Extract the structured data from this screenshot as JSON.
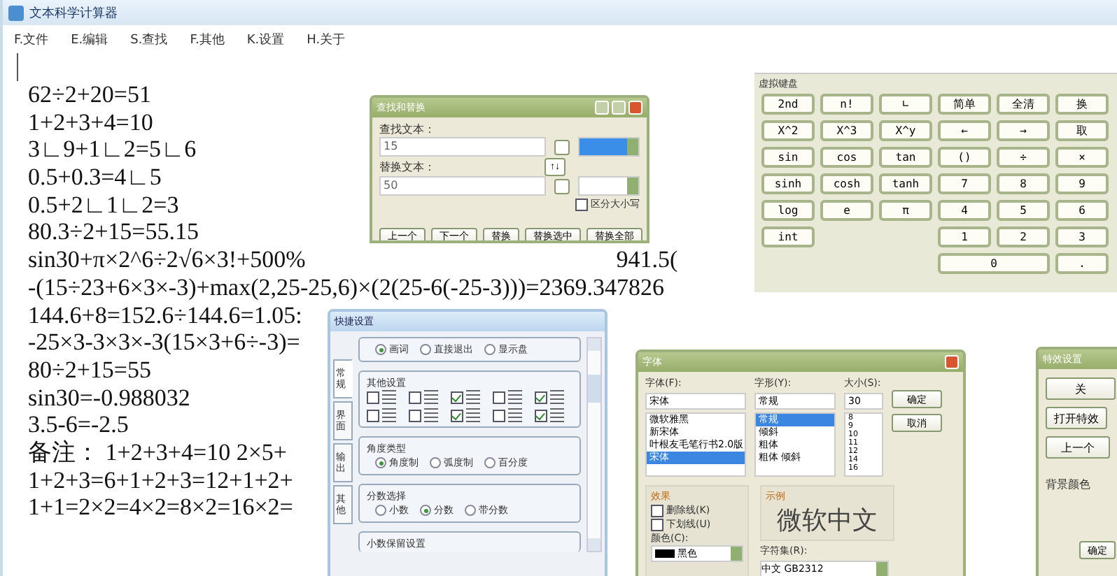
{
  "window": {
    "title": "文本科学计算器"
  },
  "menu": [
    {
      "label": "F.文件"
    },
    {
      "label": "E.编辑"
    },
    {
      "label": "S.查找"
    },
    {
      "label": "F.其他"
    },
    {
      "label": "K.设置"
    },
    {
      "label": "H.关于"
    }
  ],
  "document": {
    "lines": [
      {
        "text": "62÷2+20=51"
      },
      {
        "text": "1+2+3+4=10"
      },
      {
        "text": "3∟9+1∟2=5∟6"
      },
      {
        "text": "0.5+0.3=4∟5"
      },
      {
        "text": "0.5+2∟1∟2=3"
      },
      {
        "text": "80.3÷2+15=55.15"
      },
      {
        "text": "sin30+π×2^6÷2√6×3!+500%",
        "tail": "941.5("
      },
      {
        "text": "-(15÷23+6×3×-3)+max(2,25-25,6)×(2(25-6(-25-3)))=2369.347826"
      },
      {
        "text": "144.6+8=152.6÷144.6=1.05:"
      },
      {
        "text": "-25×3-3×3×-3(15×3+6÷-3)="
      },
      {
        "text": "80÷2+15=55"
      },
      {
        "text": "sin30=-0.988032"
      },
      {
        "text": "3.5-6=-2.5"
      },
      {
        "text": "备注：  1+2+3+4=10  2×5+"
      },
      {
        "text": "1+2+3=6+1+2+3=12+1+2+"
      },
      {
        "text": "1+1=2×2=4×2=8×2=16×2="
      }
    ]
  },
  "find_dialog": {
    "title": "查找和替换",
    "find_label": "查找文本：",
    "find_value": "15",
    "replace_label": "替换文本：",
    "replace_value": "50",
    "swap": "↑↓",
    "match_case": {
      "label": "区分大小写",
      "checked": false
    },
    "buttons": [
      {
        "label": "上一个"
      },
      {
        "label": "下一个"
      },
      {
        "label": "替换"
      },
      {
        "label": "替换选中"
      },
      {
        "label": "替换全部"
      }
    ]
  },
  "keyboard": {
    "title": "虚拟键盘",
    "rows": [
      [
        {
          "kind": "key",
          "label": "2nd"
        },
        {
          "kind": "key",
          "label": "n!"
        },
        {
          "kind": "key",
          "label": "∟"
        },
        {
          "kind": "key",
          "label": "简单"
        },
        {
          "kind": "key",
          "label": "全清"
        },
        {
          "kind": "key",
          "label": "换"
        }
      ],
      [
        {
          "kind": "key",
          "label": "X^2"
        },
        {
          "kind": "key",
          "label": "X^3"
        },
        {
          "kind": "key",
          "label": "X^y"
        },
        {
          "kind": "key",
          "label": "←"
        },
        {
          "kind": "key",
          "label": "→"
        },
        {
          "kind": "key",
          "label": "取"
        }
      ],
      [
        {
          "kind": "key",
          "label": "sin"
        },
        {
          "kind": "key",
          "label": "cos"
        },
        {
          "kind": "key",
          "label": "tan"
        },
        {
          "kind": "key",
          "label": "()"
        },
        {
          "kind": "key",
          "label": "÷"
        },
        {
          "kind": "key",
          "label": "×"
        }
      ],
      [
        {
          "kind": "key",
          "label": "sinh"
        },
        {
          "kind": "key",
          "label": "cosh"
        },
        {
          "kind": "key",
          "label": "tanh"
        },
        {
          "kind": "key",
          "label": "7"
        },
        {
          "kind": "key",
          "label": "8"
        },
        {
          "kind": "key",
          "label": "9"
        }
      ],
      [
        {
          "kind": "key",
          "label": "log"
        },
        {
          "kind": "key",
          "label": "e"
        },
        {
          "kind": "key",
          "label": "π"
        },
        {
          "kind": "key",
          "label": "4"
        },
        {
          "kind": "key",
          "label": "5"
        },
        {
          "kind": "key",
          "label": "6"
        }
      ],
      [
        {
          "kind": "key",
          "label": "int"
        },
        {
          "kind": "gap"
        },
        {
          "kind": "gap"
        },
        {
          "kind": "key",
          "label": "1"
        },
        {
          "kind": "key",
          "label": "2"
        },
        {
          "kind": "key",
          "label": "3"
        }
      ],
      [
        {
          "kind": "gap"
        },
        {
          "kind": "gap"
        },
        {
          "kind": "gap"
        },
        {
          "kind": "wide",
          "label": "0"
        },
        {
          "kind": "span"
        },
        {
          "kind": "key",
          "label": "."
        }
      ]
    ]
  },
  "settings_dialog": {
    "title": "快捷设置",
    "tabs": [
      {
        "label": "常规",
        "selected": true
      },
      {
        "label": "界面",
        "selected": false
      },
      {
        "label": "输出",
        "selected": false
      },
      {
        "label": "其他",
        "selected": false
      }
    ],
    "groups": [
      {
        "kind": "radios",
        "items": [
          {
            "label": "画词",
            "selected": true
          },
          {
            "label": "直接退出",
            "selected": false
          },
          {
            "label": "显示盘",
            "selected": false
          }
        ]
      },
      {
        "kind": "checks",
        "title": "其他设置",
        "items": [
          {
            "checked": false
          },
          {
            "checked": false
          },
          {
            "checked": true
          },
          {
            "checked": false
          },
          {
            "checked": true
          },
          {
            "checked": false
          },
          {
            "checked": false
          },
          {
            "checked": true
          },
          {
            "checked": false
          },
          {
            "checked": true
          }
        ]
      },
      {
        "kind": "radios",
        "title": "角度类型",
        "items": [
          {
            "label": "角度制",
            "selected": true
          },
          {
            "label": "弧度制",
            "selected": false
          },
          {
            "label": "百分度",
            "selected": false
          }
        ]
      },
      {
        "kind": "radios",
        "title": "分数选择",
        "items": [
          {
            "label": "小数",
            "selected": false
          },
          {
            "label": "分数",
            "selected": true
          },
          {
            "label": "带分数",
            "selected": false
          }
        ]
      },
      {
        "kind": "heading",
        "title": "小数保留设置"
      }
    ]
  },
  "font_dialog": {
    "title": "字体",
    "font": {
      "label": "字体(F):",
      "value": "宋体",
      "items": [
        {
          "label": "微软雅黑",
          "selected": false
        },
        {
          "label": "新宋体",
          "selected": false
        },
        {
          "label": "叶根友毛笔行书2.0版",
          "selected": false
        },
        {
          "label": "宋体",
          "selected": true
        }
      ]
    },
    "style": {
      "label": "字形(Y):",
      "value": "常规",
      "items": [
        {
          "label": "常规",
          "selected": true
        },
        {
          "label": "倾斜",
          "selected": false
        },
        {
          "label": "粗体",
          "selected": false
        },
        {
          "label": "粗体 倾斜",
          "selected": false
        }
      ]
    },
    "size": {
      "label": "大小(S):",
      "value": "30",
      "items": [
        {
          "label": "8",
          "selected": false
        },
        {
          "label": "9",
          "selected": false
        },
        {
          "label": "10",
          "selected": false
        },
        {
          "label": "11",
          "selected": false
        },
        {
          "label": "12",
          "selected": false
        },
        {
          "label": "14",
          "selected": false
        },
        {
          "label": "16",
          "selected": false
        }
      ]
    },
    "buttons": [
      {
        "label": "确定"
      },
      {
        "label": "取消"
      }
    ],
    "effects": {
      "title": "效果",
      "checks": [
        {
          "label": "删除线(K)",
          "checked": false
        },
        {
          "label": "下划线(U)",
          "checked": false
        }
      ],
      "color_label": "颜色(C):",
      "color_value": "黑色"
    },
    "sample": {
      "title": "示例",
      "text": "微软中文"
    },
    "charset": {
      "label": "字符集(R):",
      "value": "中文 GB2312"
    }
  },
  "effects_dialog": {
    "title": "特效设置",
    "buttons": [
      {
        "label": "关"
      },
      {
        "label": "打开特效"
      },
      {
        "label": "上一个"
      }
    ],
    "bg_label": "背景颜色",
    "ok": "确定"
  }
}
